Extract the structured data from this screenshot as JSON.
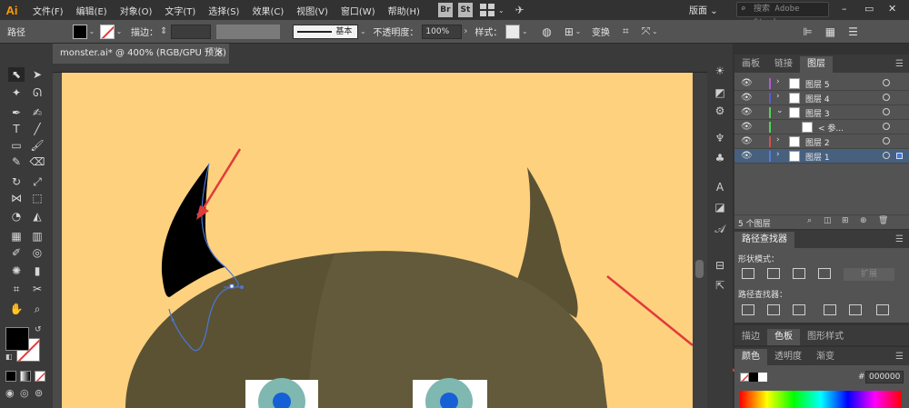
{
  "app": {
    "logo": "Ai"
  },
  "menu": [
    "文件(F)",
    "编辑(E)",
    "对象(O)",
    "文字(T)",
    "选择(S)",
    "效果(C)",
    "视图(V)",
    "窗口(W)",
    "帮助(H)"
  ],
  "bridge": {
    "br": "Br",
    "st": "St"
  },
  "workspace": {
    "label": "版面",
    "chevron": "⌄"
  },
  "search": {
    "placeholder": "搜索 Adobe Stock"
  },
  "window_controls": {
    "minimize": "–",
    "restore": "▭",
    "close": "✕"
  },
  "control_bar": {
    "path_label": "路径",
    "stroke_label": "描边：",
    "brush_value": "基本",
    "opacity_label": "不透明度：",
    "opacity_value": "100%",
    "style_label": "样式：",
    "transform_label": "变换"
  },
  "document": {
    "tab_title": "monster.ai* @ 400% (RGB/GPU 预览)",
    "close": "✕"
  },
  "layers_panel": {
    "tabs": [
      "画板",
      "链接",
      "图层"
    ],
    "active_tab": "图层",
    "rows": [
      {
        "name": "图层 5",
        "color": "#b05bd6",
        "expand": "›",
        "selected": false,
        "indent": false
      },
      {
        "name": "图层 4",
        "color": "#5a5ad6",
        "expand": "›",
        "selected": false,
        "indent": false
      },
      {
        "name": "图层 3",
        "color": "#4fd64f",
        "expand": "⌄",
        "selected": false,
        "indent": false
      },
      {
        "name": "< 参...",
        "color": "#4fd64f",
        "expand": "",
        "selected": false,
        "indent": true
      },
      {
        "name": "图层 2",
        "color": "#d64f4f",
        "expand": "›",
        "selected": false,
        "indent": false
      },
      {
        "name": "图层 1",
        "color": "#5a7ad6",
        "expand": "›",
        "selected": true,
        "indent": false
      }
    ],
    "footer_count": "5 个图层"
  },
  "pathfinder_panel": {
    "title": "路径查找器",
    "shape_modes_label": "形状模式：",
    "expand_button": "扩展",
    "pathfinders_label": "路径查找器："
  },
  "color_panel_tabs_top": [
    "描边",
    "色板",
    "图形样式"
  ],
  "color_panel_tabs_top_active": "色板",
  "color_panel_tabs": [
    "颜色",
    "透明度",
    "渐变"
  ],
  "color_panel_active": "颜色",
  "color_panel": {
    "hex_label": "#",
    "hex_value": "000000"
  },
  "colors": {
    "artboard": "#fdd17e",
    "monster_body": "#5b5234",
    "monster_body_light": "#635a3b",
    "horn": "#5b5234",
    "selected_horn": "#000000",
    "path_stroke": "#4a78d6",
    "arrow": "#e03b3b",
    "eye_white": "#ffffff",
    "iris": "#7fb8b0",
    "pupil": "#1560d6"
  }
}
